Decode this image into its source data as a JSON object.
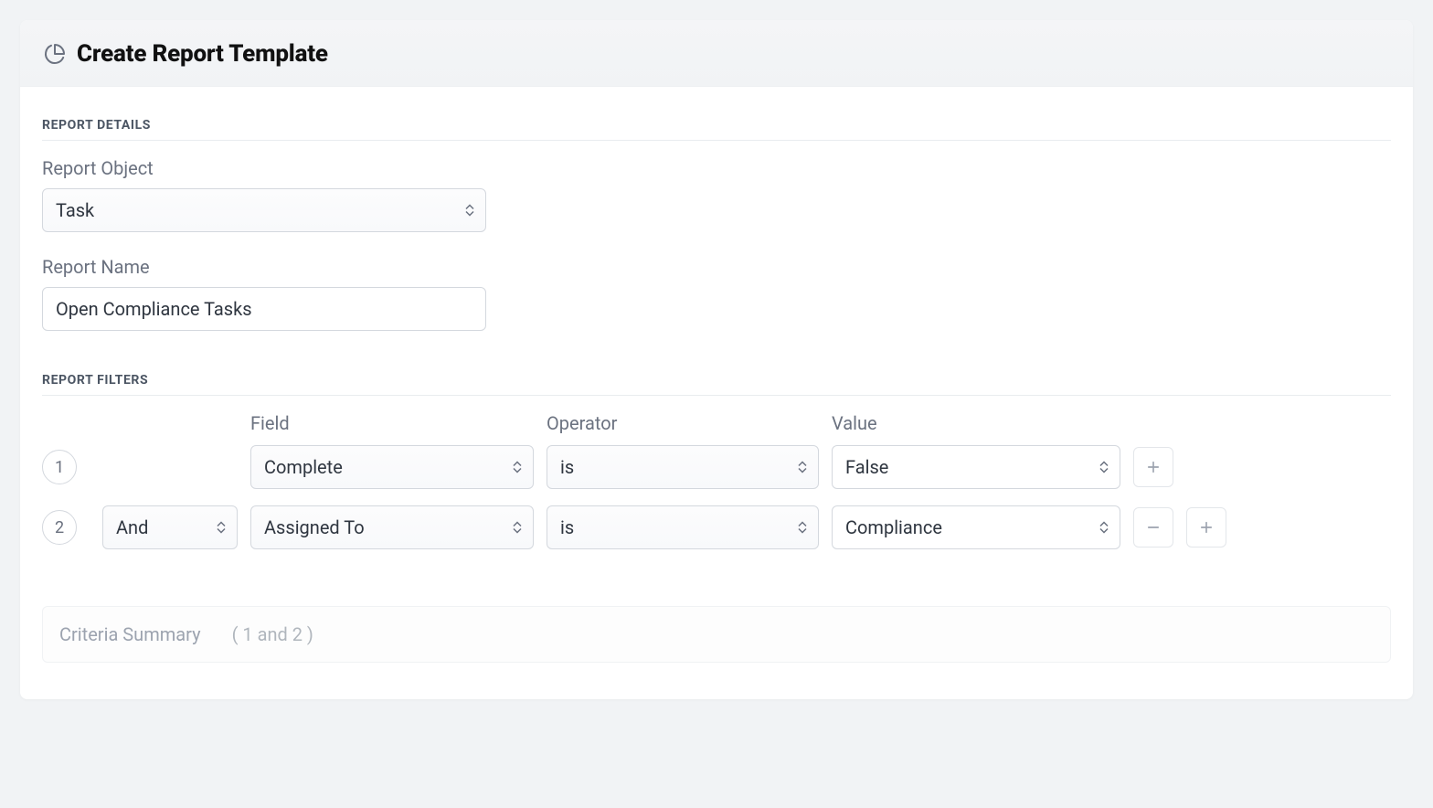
{
  "header": {
    "title": "Create Report Template"
  },
  "sections": {
    "details": "REPORT DETAILS",
    "filters": "REPORT FILTERS"
  },
  "details": {
    "report_object_label": "Report Object",
    "report_object_value": "Task",
    "report_name_label": "Report Name",
    "report_name_value": "Open Compliance Tasks"
  },
  "filters": {
    "headers": {
      "field": "Field",
      "operator": "Operator",
      "value": "Value"
    },
    "rows": [
      {
        "num": "1",
        "logic": "",
        "field": "Complete",
        "operator": "is",
        "value": "False"
      },
      {
        "num": "2",
        "logic": "And",
        "field": "Assigned To",
        "operator": "is",
        "value": "Compliance"
      }
    ]
  },
  "criteria": {
    "label": "Criteria Summary",
    "value": "( 1 and 2 )"
  }
}
